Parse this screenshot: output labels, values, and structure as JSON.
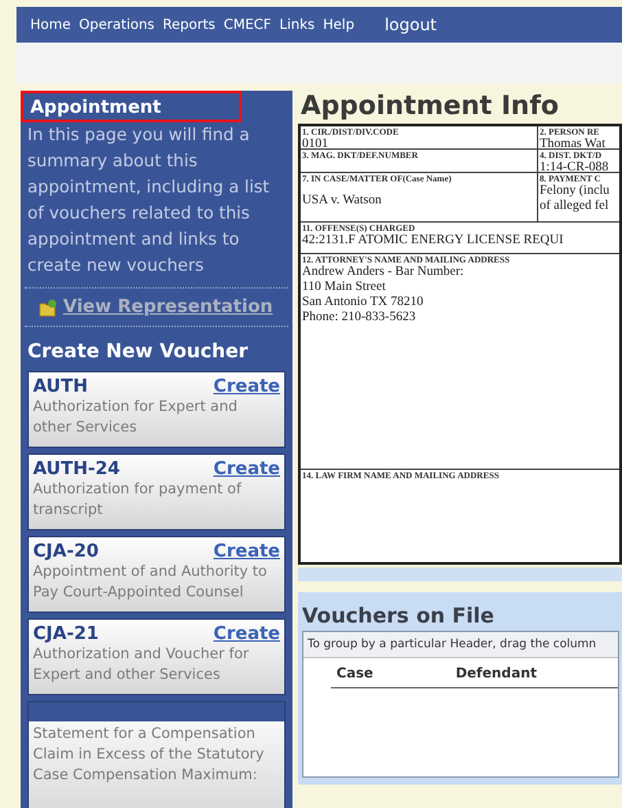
{
  "nav": {
    "items": [
      "Home",
      "Operations",
      "Reports",
      "CMECF",
      "Links",
      "Help"
    ],
    "logout": "logout"
  },
  "sidebar": {
    "heading": "Appointment",
    "description": "In this page you will find a summary about this appointment, including a list of vouchers related to this appointment and links to create new vouchers",
    "view_link": "View Representation",
    "create_heading": "Create New Voucher",
    "vouchers": [
      {
        "code": "AUTH",
        "action": "Create",
        "description": "Authorization for Expert and other Services"
      },
      {
        "code": "AUTH-24",
        "action": "Create",
        "description": "Authorization for payment of transcript"
      },
      {
        "code": "CJA-20",
        "action": "Create",
        "description": "Appointment of and Authority to Pay Court-Appointed Counsel"
      },
      {
        "code": "CJA-21",
        "action": "Create",
        "description": "Authorization and Voucher for Expert and other Services"
      },
      {
        "description": "Statement for a Compensation Claim in Excess of the Statutory Case Compensation Maximum:"
      }
    ]
  },
  "title": "Appointment Info",
  "form": {
    "rows": [
      {
        "cells": [
          {
            "label": "1. CIR./DIST/DIV.CODE",
            "lines": [
              "0101"
            ]
          },
          {
            "label": "2. PERSON RE",
            "lines": [
              "Thomas Wat"
            ]
          }
        ]
      },
      {
        "cells": [
          {
            "label": "3. MAG. DKT/DEF.NUMBER"
          },
          {
            "label": "4. DIST. DKT/D",
            "lines": [
              "1:14-CR-088"
            ]
          }
        ]
      },
      {
        "cells": [
          {
            "label": "7. IN CASE/MATTER OF(Case Name)",
            "lines": [
              "USA v. Watson"
            ]
          },
          {
            "label": "8. PAYMENT C",
            "lines": [
              "Felony (inclu",
              "of alleged fel"
            ]
          }
        ]
      },
      {
        "cells": [
          {
            "label": "11. OFFENSE(S) CHARGED",
            "lines": [
              "42:2131.F ATOMIC ENERGY LICENSE REQUI"
            ]
          }
        ]
      },
      {
        "cells": [
          {
            "label": "12. ATTORNEY'S NAME AND MAILING ADDRESS",
            "lines": [
              "Andrew Anders - Bar Number:",
              "110 Main Street",
              "San Antonio TX 78210",
              "Phone: 210-833-5623"
            ]
          }
        ]
      },
      {
        "cells": [
          {
            "label": "14. LAW FIRM NAME AND MAILING ADDRESS"
          }
        ]
      }
    ]
  },
  "vouchers_on_file": {
    "title": "Vouchers on File",
    "group_hint": "To group by a particular Header, drag the column",
    "columns": [
      "Case",
      "Defendant"
    ]
  }
}
